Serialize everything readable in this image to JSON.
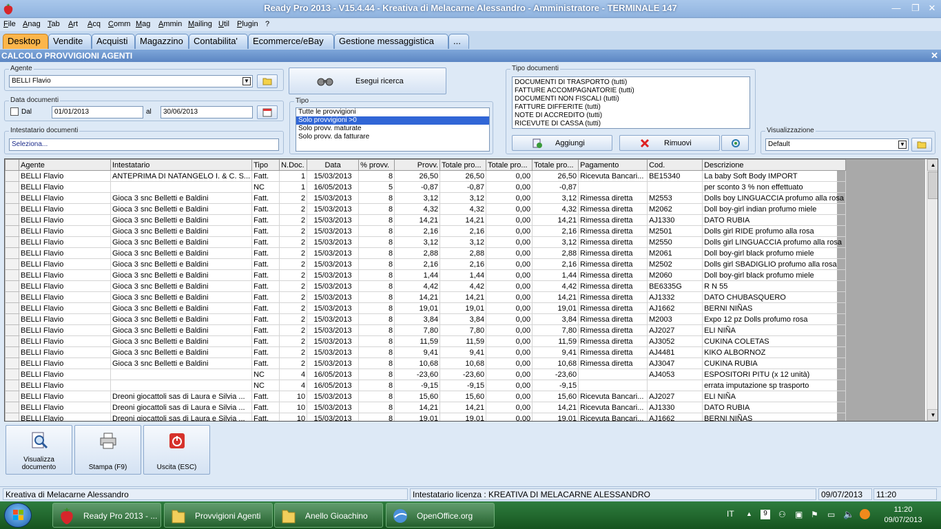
{
  "titlebar": {
    "title": "Ready Pro 2013 - V15.4.44 - Kreativa di Melacarne Alessandro - Amministratore - TERMINALE 147",
    "min": "—",
    "max": "❐",
    "close": "✕"
  },
  "menu": [
    "File",
    "Anag",
    "Tab",
    "Art",
    "Acq",
    "Comm",
    "Mag",
    "Ammin",
    "Mailing",
    "Util",
    "Plugin",
    "?"
  ],
  "tabs": [
    "Desktop",
    "Vendite",
    "Acquisti",
    "Magazzino",
    "Contabilita'",
    "Ecommerce/eBay",
    "Gestione messaggistica",
    "..."
  ],
  "window": {
    "title": "CALCOLO PROVVIGIONI AGENTI",
    "close": "✕"
  },
  "filters": {
    "agente_label": "Agente",
    "agente_value": "BELLI Flavio",
    "data_label": "Data documenti",
    "dal_label": "Dal",
    "dal_value": "01/01/2013",
    "al_label": "al",
    "al_value": "30/06/2013",
    "intestatario_label": "Intestatario documenti",
    "intestatario_placeholder": "Seleziona...",
    "search_button": "Esegui ricerca",
    "tipo_label": "Tipo",
    "tipo_options": [
      "Tutte le provvigioni",
      "Solo provvigioni >0",
      "Solo provv. maturate",
      "Solo provv. da fatturare"
    ],
    "tipo_selected": 1,
    "tipodoc_label": "Tipo documenti",
    "tipodoc_items": [
      "DOCUMENTI DI TRASPORTO (tutti)",
      "FATTURE ACCOMPAGNATORIE (tutti)",
      "DOCUMENTI NON FISCALI (tutti)",
      "FATTURE DIFFERITE (tutti)",
      "NOTE DI ACCREDITO (tutti)",
      "RICEVUTE DI CASSA (tutti)"
    ],
    "aggiungi": "Aggiungi",
    "rimuovi": "Rimuovi",
    "visual_label": "Visualizzazione",
    "visual_value": "Default"
  },
  "grid": {
    "columns": [
      "Agente",
      "Intestatario",
      "Tipo",
      "N.Doc.",
      "Data",
      "% provv.",
      "Provv.",
      "Totale pro...",
      "Totale pro...",
      "Totale pro...",
      "Pagamento",
      "Cod.",
      "Descrizione"
    ],
    "rows": [
      [
        "BELLI Flavio",
        "ANTEPRIMA DI NATANGELO I. & C. S...",
        "Fatt.",
        "1",
        "15/03/2013",
        "8",
        "26,50",
        "26,50",
        "0,00",
        "26,50",
        "Ricevuta Bancari...",
        "BE15340",
        "La baby Soft Body        IMPORT"
      ],
      [
        "BELLI Flavio",
        "",
        "NC",
        "1",
        "16/05/2013",
        "5",
        "-0,87",
        "-0,87",
        "0,00",
        "-0,87",
        "",
        "",
        "per sconto 3 % non effettuato"
      ],
      [
        "BELLI Flavio",
        "Gioca 3 snc Belletti e Baldini",
        "Fatt.",
        "2",
        "15/03/2013",
        "8",
        "3,12",
        "3,12",
        "0,00",
        "3,12",
        "Rimessa diretta",
        "M2553",
        "Dolls boy LINGUACCIA profumo alla rosa"
      ],
      [
        "BELLI Flavio",
        "Gioca 3 snc Belletti e Baldini",
        "Fatt.",
        "2",
        "15/03/2013",
        "8",
        "4,32",
        "4,32",
        "0,00",
        "4,32",
        "Rimessa diretta",
        "M2062",
        "Doll boy-girl indian  profumo miele"
      ],
      [
        "BELLI Flavio",
        "Gioca 3 snc Belletti e Baldini",
        "Fatt.",
        "2",
        "15/03/2013",
        "8",
        "14,21",
        "14,21",
        "0,00",
        "14,21",
        "Rimessa diretta",
        "AJ1330",
        "DATO RUBIA"
      ],
      [
        "BELLI Flavio",
        "Gioca 3 snc Belletti e Baldini",
        "Fatt.",
        "2",
        "15/03/2013",
        "8",
        "2,16",
        "2,16",
        "0,00",
        "2,16",
        "Rimessa diretta",
        "M2501",
        "Dolls girl RIDE profumo alla rosa"
      ],
      [
        "BELLI Flavio",
        "Gioca 3 snc Belletti e Baldini",
        "Fatt.",
        "2",
        "15/03/2013",
        "8",
        "3,12",
        "3,12",
        "0,00",
        "3,12",
        "Rimessa diretta",
        "M2550",
        "Dolls girl LINGUACCIA profumo alla rosa"
      ],
      [
        "BELLI Flavio",
        "Gioca 3 snc Belletti e Baldini",
        "Fatt.",
        "2",
        "15/03/2013",
        "8",
        "2,88",
        "2,88",
        "0,00",
        "2,88",
        "Rimessa diretta",
        "M2061",
        "Doll boy-girl black profumo miele"
      ],
      [
        "BELLI Flavio",
        "Gioca 3 snc Belletti e Baldini",
        "Fatt.",
        "2",
        "15/03/2013",
        "8",
        "2,16",
        "2,16",
        "0,00",
        "2,16",
        "Rimessa diretta",
        "M2502",
        "Dolls girl SBADIGLIO profumo alla rosa"
      ],
      [
        "BELLI Flavio",
        "Gioca 3 snc Belletti e Baldini",
        "Fatt.",
        "2",
        "15/03/2013",
        "8",
        "1,44",
        "1,44",
        "0,00",
        "1,44",
        "Rimessa diretta",
        "M2060",
        "Doll boy-girl black profumo miele"
      ],
      [
        "BELLI Flavio",
        "Gioca 3 snc Belletti e Baldini",
        "Fatt.",
        "2",
        "15/03/2013",
        "8",
        "4,42",
        "4,42",
        "0,00",
        "4,42",
        "Rimessa diretta",
        "BE6335G",
        "R N 55"
      ],
      [
        "BELLI Flavio",
        "Gioca 3 snc Belletti e Baldini",
        "Fatt.",
        "2",
        "15/03/2013",
        "8",
        "14,21",
        "14,21",
        "0,00",
        "14,21",
        "Rimessa diretta",
        "AJ1332",
        "DATO CHUBASQUERO"
      ],
      [
        "BELLI Flavio",
        "Gioca 3 snc Belletti e Baldini",
        "Fatt.",
        "2",
        "15/03/2013",
        "8",
        "19,01",
        "19,01",
        "0,00",
        "19,01",
        "Rimessa diretta",
        "AJ1662",
        "BERNI NIÑAS"
      ],
      [
        "BELLI Flavio",
        "Gioca 3 snc Belletti e Baldini",
        "Fatt.",
        "2",
        "15/03/2013",
        "8",
        "3,84",
        "3,84",
        "0,00",
        "3,84",
        "Rimessa diretta",
        "M2003",
        "Expo 12 pz Dolls profumo rosa"
      ],
      [
        "BELLI Flavio",
        "Gioca 3 snc Belletti e Baldini",
        "Fatt.",
        "2",
        "15/03/2013",
        "8",
        "7,80",
        "7,80",
        "0,00",
        "7,80",
        "Rimessa diretta",
        "AJ2027",
        "ELI NIÑA"
      ],
      [
        "BELLI Flavio",
        "Gioca 3 snc Belletti e Baldini",
        "Fatt.",
        "2",
        "15/03/2013",
        "8",
        "11,59",
        "11,59",
        "0,00",
        "11,59",
        "Rimessa diretta",
        "AJ3052",
        "CUKINA COLETAS"
      ],
      [
        "BELLI Flavio",
        "Gioca 3 snc Belletti e Baldini",
        "Fatt.",
        "2",
        "15/03/2013",
        "8",
        "9,41",
        "9,41",
        "0,00",
        "9,41",
        "Rimessa diretta",
        "AJ4481",
        "KIKO ALBORNOZ"
      ],
      [
        "BELLI Flavio",
        "Gioca 3 snc Belletti e Baldini",
        "Fatt.",
        "2",
        "15/03/2013",
        "8",
        "10,68",
        "10,68",
        "0,00",
        "10,68",
        "Rimessa diretta",
        "AJ3047",
        "CUKINA RUBIA"
      ],
      [
        "BELLI Flavio",
        "",
        "NC",
        "4",
        "16/05/2013",
        "8",
        "-23,60",
        "-23,60",
        "0,00",
        "-23,60",
        "",
        "AJ4053",
        "ESPOSITORI PITU (x 12 unità)"
      ],
      [
        "BELLI Flavio",
        "",
        "NC",
        "4",
        "16/05/2013",
        "8",
        "-9,15",
        "-9,15",
        "0,00",
        "-9,15",
        "",
        "",
        "errata imputazione sp trasporto"
      ],
      [
        "BELLI Flavio",
        "Dreoni giocattoli sas di Laura e Silvia ...",
        "Fatt.",
        "10",
        "15/03/2013",
        "8",
        "15,60",
        "15,60",
        "0,00",
        "15,60",
        "Ricevuta Bancari...",
        "AJ2027",
        "ELI NIÑA"
      ],
      [
        "BELLI Flavio",
        "Dreoni giocattoli sas di Laura e Silvia ...",
        "Fatt.",
        "10",
        "15/03/2013",
        "8",
        "14,21",
        "14,21",
        "0,00",
        "14,21",
        "Ricevuta Bancari...",
        "AJ1330",
        "DATO RUBIA"
      ],
      [
        "BELLI Flavio",
        "Dreoni giocattoli sas di Laura e Silvia ...",
        "Fatt.",
        "10",
        "15/03/2013",
        "8",
        "19,01",
        "19,01",
        "0,00",
        "19,01",
        "Ricevuta Bancari...",
        "AJ1662",
        "BERNI NIÑAS"
      ]
    ]
  },
  "actions": {
    "visualizza": "Visualizza documento",
    "stampa": "Stampa (F9)",
    "uscita": "Uscita (ESC)"
  },
  "status": {
    "company": "Kreativa di Melacarne Alessandro",
    "license": "Intestatario licenza : KREATIVA DI MELACARNE ALESSANDRO",
    "date": "09/07/2013",
    "time": "11:20"
  },
  "taskbar": {
    "tasks": [
      "Ready Pro 2013 - ...",
      "Provvigioni Agenti",
      "Anello Gioachino",
      "OpenOffice.org"
    ],
    "lang": "IT",
    "clock_time": "11:20",
    "clock_date": "09/07/2013"
  },
  "colors": {
    "active_tab": "#fcb64b",
    "selection": "#3166d6",
    "taskbar": "#1f6a2c"
  }
}
